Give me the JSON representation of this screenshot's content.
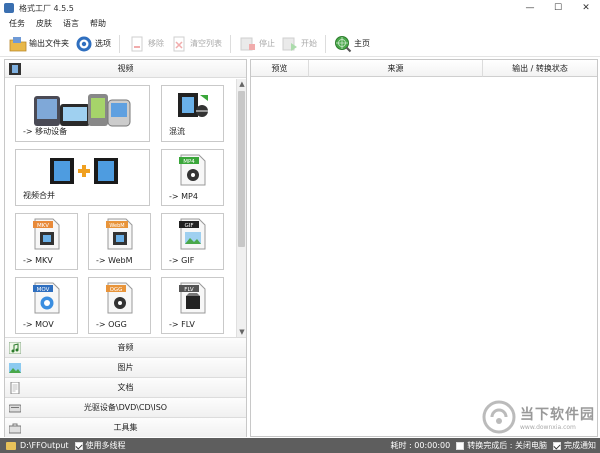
{
  "window": {
    "title": "格式工厂 4.5.5",
    "minimize": "—",
    "maximize": "☐",
    "close": "✕"
  },
  "menu": [
    "任务",
    "皮肤",
    "语言",
    "帮助"
  ],
  "toolbar": {
    "output_folder": "输出文件夹",
    "options": "选项",
    "remove": "移除",
    "clear_list": "清空列表",
    "stop": "停止",
    "start": "开始",
    "homepage": "主页"
  },
  "left_panel": {
    "video_header": "视频",
    "tiles": [
      {
        "label": "-> 移动设备"
      },
      {
        "label": "混流"
      },
      {
        "label": "视频合并"
      },
      {
        "label": "-> MP4",
        "badge": "MP4"
      },
      {
        "label": "-> MKV",
        "badge": "MKV"
      },
      {
        "label": "-> WebM",
        "badge": "WebM"
      },
      {
        "label": "-> GIF",
        "badge": "GIF"
      },
      {
        "label": "-> MOV",
        "badge": "MOV"
      },
      {
        "label": "-> OGG",
        "badge": "OGG"
      },
      {
        "label": "-> FLV",
        "badge": "FLV"
      }
    ],
    "categories": [
      {
        "label": "音频"
      },
      {
        "label": "图片"
      },
      {
        "label": "文档"
      },
      {
        "label": "光驱设备\\DVD\\CD\\ISO"
      },
      {
        "label": "工具集"
      }
    ]
  },
  "task_table": {
    "columns": [
      "预览",
      "来源",
      "输出 / 转换状态"
    ]
  },
  "status_bar": {
    "output_path": "D:\\FFOutput",
    "multithread_label": "使用多线程",
    "multithread_checked": true,
    "elapsed_label": "耗时 : 00:00:00",
    "after_convert_label": "转换完成后 : 关闭电脑",
    "after_convert_checked": false,
    "notify_label": "完成通知",
    "notify_checked": true
  },
  "watermark": {
    "name": "当下软件园",
    "url": "www.downxia.com"
  }
}
